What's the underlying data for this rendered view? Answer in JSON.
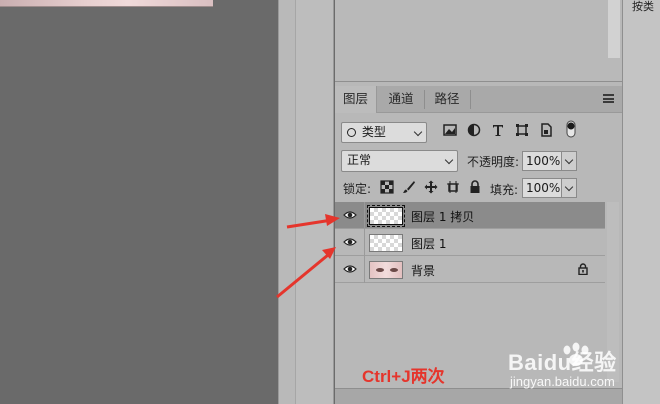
{
  "tabs": [
    {
      "label": "图层",
      "active": true
    },
    {
      "label": "通道",
      "active": false
    },
    {
      "label": "路径",
      "active": false
    }
  ],
  "filter": {
    "label": "类型"
  },
  "blend_mode": {
    "value": "正常"
  },
  "opacity": {
    "label": "不透明度:",
    "value": "100%"
  },
  "lock": {
    "label": "锁定:"
  },
  "fill": {
    "label": "填充:",
    "value": "100%"
  },
  "layers": [
    {
      "name": "图层 1 拷贝",
      "selected": true,
      "thumbnail": "transparent",
      "visible": true,
      "locked": false
    },
    {
      "name": "图层 1",
      "selected": false,
      "thumbnail": "transparent",
      "visible": true,
      "locked": false
    },
    {
      "name": "背景",
      "selected": false,
      "thumbnail": "face",
      "visible": true,
      "locked": true
    }
  ],
  "annotation": {
    "text": "Ctrl+J两次",
    "color": "#e5352c"
  },
  "right_panel": {
    "label": "按类"
  },
  "watermark": {
    "brand": "Baidu经验",
    "url": "jingyan.baidu.com"
  },
  "colors": {
    "panel": "#b8b8b8",
    "selected_layer": "#8b8b8b",
    "canvas": "#6a6a6a",
    "arrow": "#e5352c"
  }
}
